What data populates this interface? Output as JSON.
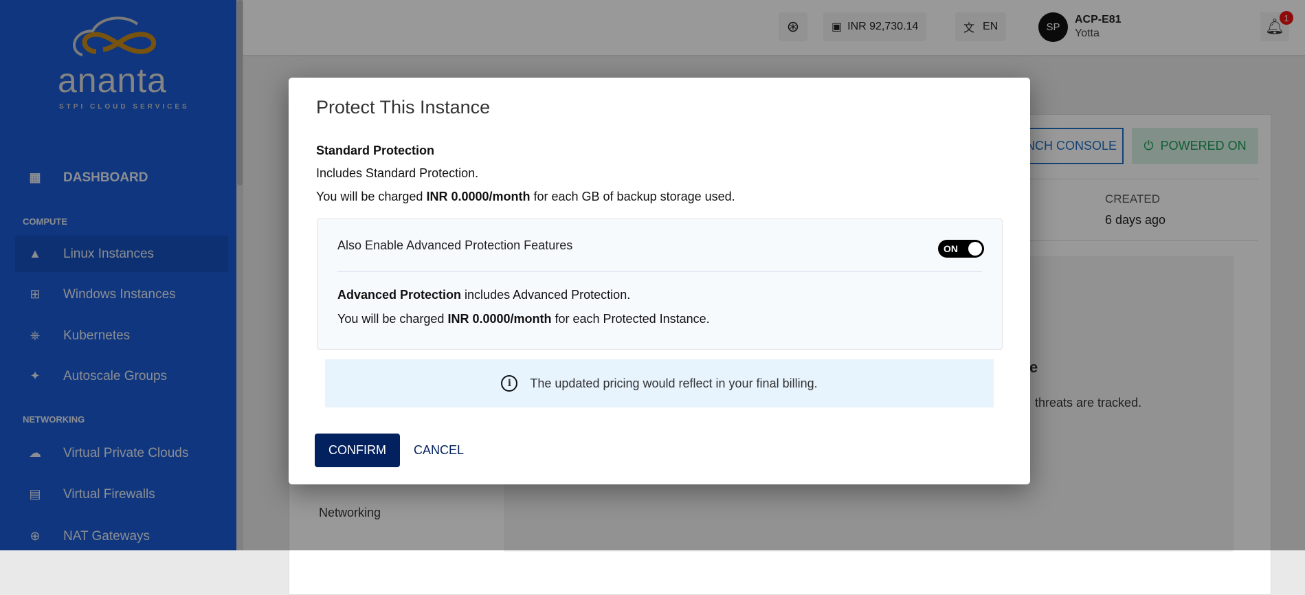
{
  "brand": {
    "logo_text": "ananta",
    "logo_sub": "STPI CLOUD SERVICES"
  },
  "sidebar": {
    "dashboard": "DASHBOARD",
    "sections": [
      {
        "title": "COMPUTE",
        "items": [
          {
            "label": "Linux Instances",
            "icon": "linux-icon",
            "active": true
          },
          {
            "label": "Windows Instances",
            "icon": "windows-icon"
          },
          {
            "label": "Kubernetes",
            "icon": "kubernetes-icon"
          },
          {
            "label": "Autoscale Groups",
            "icon": "magic-wand-icon"
          }
        ]
      },
      {
        "title": "NETWORKING",
        "items": [
          {
            "label": "Virtual Private Clouds",
            "icon": "cloud-lock-icon"
          },
          {
            "label": "Virtual Firewalls",
            "icon": "firewall-icon"
          },
          {
            "label": "NAT Gateways",
            "icon": "nat-icon"
          }
        ]
      }
    ]
  },
  "header": {
    "balance": "INR 92,730.14",
    "language": "EN",
    "avatar": "SP",
    "user": "ACP-E81",
    "org": "Yotta",
    "notifications": "1"
  },
  "background": {
    "launch_console": "NCH CONSOLE",
    "powered_on": "POWERED ON",
    "created_label": "CREATED",
    "created_value": "6 days ago",
    "threats_text": "threats are tracked.",
    "heading_fragment": "e",
    "networking": "Networking"
  },
  "modal": {
    "title": "Protect This Instance",
    "standard_title": "Standard Protection",
    "standard_desc": "Includes Standard Protection.",
    "standard_charge_pre": "You will be charged ",
    "standard_charge_amount": "INR 0.0000/month",
    "standard_charge_post": " for each GB of backup storage used.",
    "advanced_toggle_label": "Also Enable Advanced Protection Features",
    "toggle_state": "ON",
    "advanced_title": "Advanced Protection",
    "advanced_desc": " includes Advanced Protection.",
    "advanced_charge_pre": "You will be charged ",
    "advanced_charge_amount": "INR 0.0000/month",
    "advanced_charge_post": " for each Protected Instance.",
    "info": "The updated pricing would reflect in your final billing.",
    "confirm": "CONFIRM",
    "cancel": "CANCEL"
  }
}
